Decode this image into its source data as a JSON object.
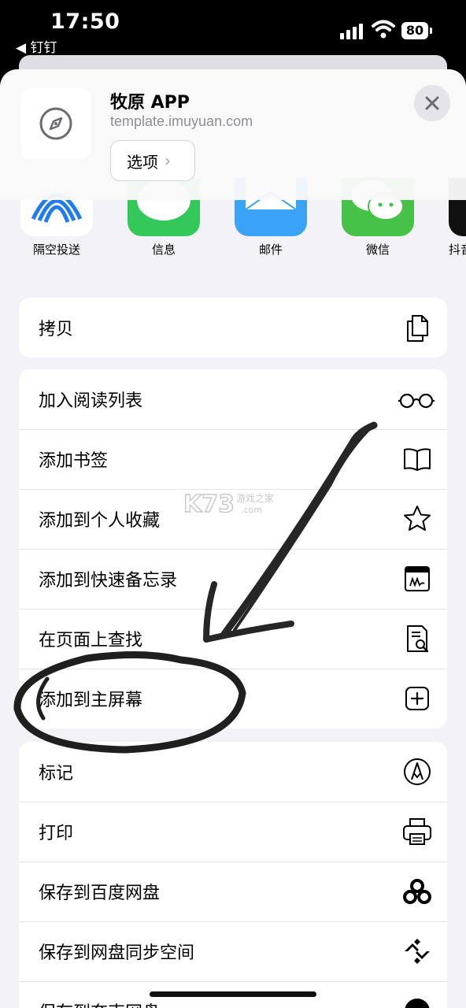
{
  "status_bar": {
    "time": "17:50",
    "back_app": "◀ 钉钉",
    "battery": "80"
  },
  "header": {
    "title": "牧原 APP",
    "url": "template.imuyuan.com",
    "options_label": "选项",
    "options_chevron": "›"
  },
  "share_apps": [
    {
      "label": "隔空投送",
      "icon": "airdrop-icon"
    },
    {
      "label": "信息",
      "icon": "messages-icon"
    },
    {
      "label": "邮件",
      "icon": "mail-icon"
    },
    {
      "label": "微信",
      "icon": "wechat-icon"
    },
    {
      "label": "抖音",
      "icon": "douyin-icon"
    }
  ],
  "actions": {
    "copy": "拷贝",
    "group2": [
      "加入阅读列表",
      "添加书签",
      "添加到个人收藏",
      "添加到快速备忘录",
      "在页面上查找",
      "添加到主屏幕"
    ],
    "group3": [
      "标记",
      "打印",
      "保存到百度网盘",
      "保存到网盘同步空间",
      "保存到夸克网盘"
    ]
  },
  "watermark": {
    "brand": "K73",
    "line1": "游戏之家",
    "line2": ".com"
  },
  "colors": {
    "messages": "#34c759",
    "mail": "#3aa2f7",
    "wechat": "#46c248",
    "separator": "#e2e2e6"
  }
}
